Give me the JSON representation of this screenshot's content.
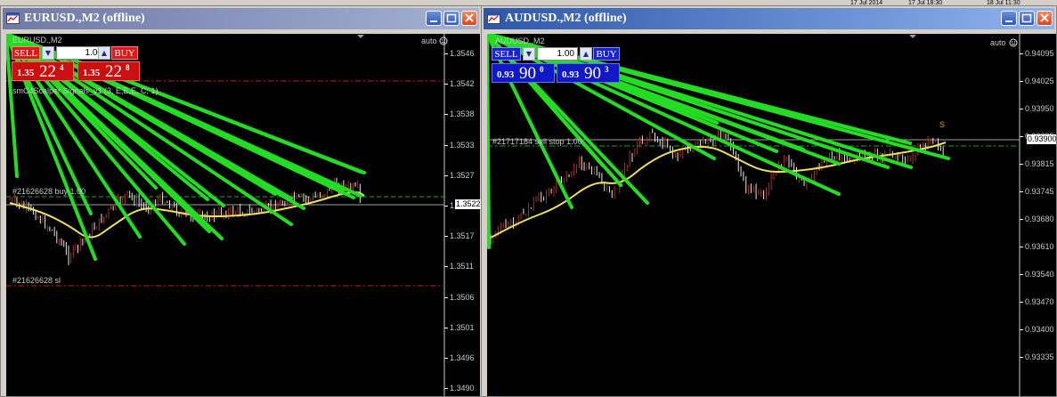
{
  "top_strip": {
    "date1": "17 Jul 2014",
    "date2": "17 Jul 18:30",
    "date3": "18 Jul 11:30"
  },
  "windows": [
    {
      "title": "EURUSD.,M2 (offline)",
      "chart_header": "EURUSD.,M2",
      "auto_label": "auto",
      "sell_label": "SELL",
      "buy_label": "BUY",
      "lot_value": "1.00",
      "bid": {
        "small": "1.35",
        "big": "22",
        "sup": "4"
      },
      "ask": {
        "small": "1.35",
        "big": "22",
        "sup": "8"
      },
      "indicator_label": "smC4Scalper Signals_v1 (3, E,E,E, C; 1)",
      "order_buy_label": "#21626628 buy 1.00",
      "order_sl_label": "#21626628 sl",
      "current_price": "1.3522",
      "price_axis": [
        "1.3546",
        "1.3542",
        "1.3538",
        "1.3533",
        "1.3527",
        "1.3522",
        "1.3517",
        "1.3511",
        "1.3506",
        "1.3501",
        "1.3496",
        "1.3490"
      ]
    },
    {
      "title": "AUDUSD.,M2 (offline)",
      "chart_header": "AUDUSD.,M2",
      "auto_label": "auto",
      "sell_label": "SELL",
      "buy_label": "BUY",
      "lot_value": "1.00",
      "bid": {
        "small": "0.93",
        "big": "90",
        "sup": "0"
      },
      "ask": {
        "small": "0.93",
        "big": "90",
        "sup": "3"
      },
      "order_sellstop_label": "#21717184 sell stop 1.00",
      "sell_marker": "S",
      "current_price": "0.93900",
      "price_axis": [
        "0.94095",
        "0.94025",
        "0.93950",
        "0.93885",
        "0.93815",
        "0.93745",
        "0.93680",
        "0.93610",
        "0.93540",
        "0.93470",
        "0.93400",
        "0.93335"
      ]
    }
  ],
  "colors": {
    "bull_candle": "#b03020",
    "bear_candle": "#e8e8e8",
    "ma_line": "#f0e060",
    "signal_line": "#22dd22",
    "order_line": "#c02020",
    "active_title": "#2f57a9",
    "inactive_title": "#6f7aa6"
  }
}
